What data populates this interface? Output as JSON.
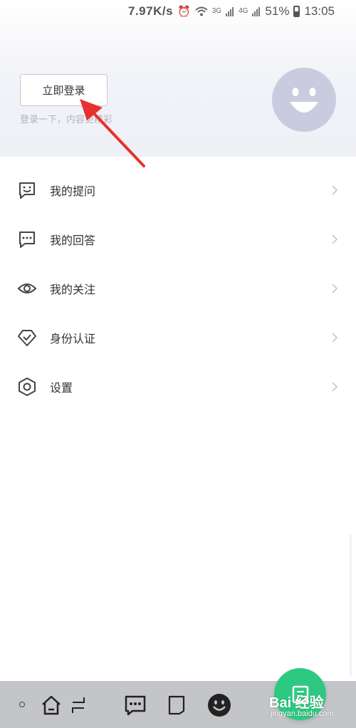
{
  "status_bar": {
    "speed": "7.97K/s",
    "network_3g": "3G",
    "network_4g": "4G",
    "battery": "51%",
    "time": "13:05"
  },
  "header": {
    "login_button": "立即登录",
    "subtitle": "登录一下，内容更精彩"
  },
  "menu": {
    "items": [
      {
        "label": "我的提问",
        "icon": "smile-chat-icon"
      },
      {
        "label": "我的回答",
        "icon": "chat-dots-icon"
      },
      {
        "label": "我的关注",
        "icon": "eye-icon"
      },
      {
        "label": "身份认证",
        "icon": "shield-check-icon"
      },
      {
        "label": "设置",
        "icon": "settings-hexagon-icon"
      }
    ]
  },
  "watermark": {
    "brand": "Bai 经验",
    "url": "jingyan.baidu.com"
  },
  "colors": {
    "accent_green": "#2ec981",
    "avatar_bg": "#c8ccde",
    "annotation_red": "#e8302f",
    "nav_bar_bg": "#c4c5c8"
  }
}
